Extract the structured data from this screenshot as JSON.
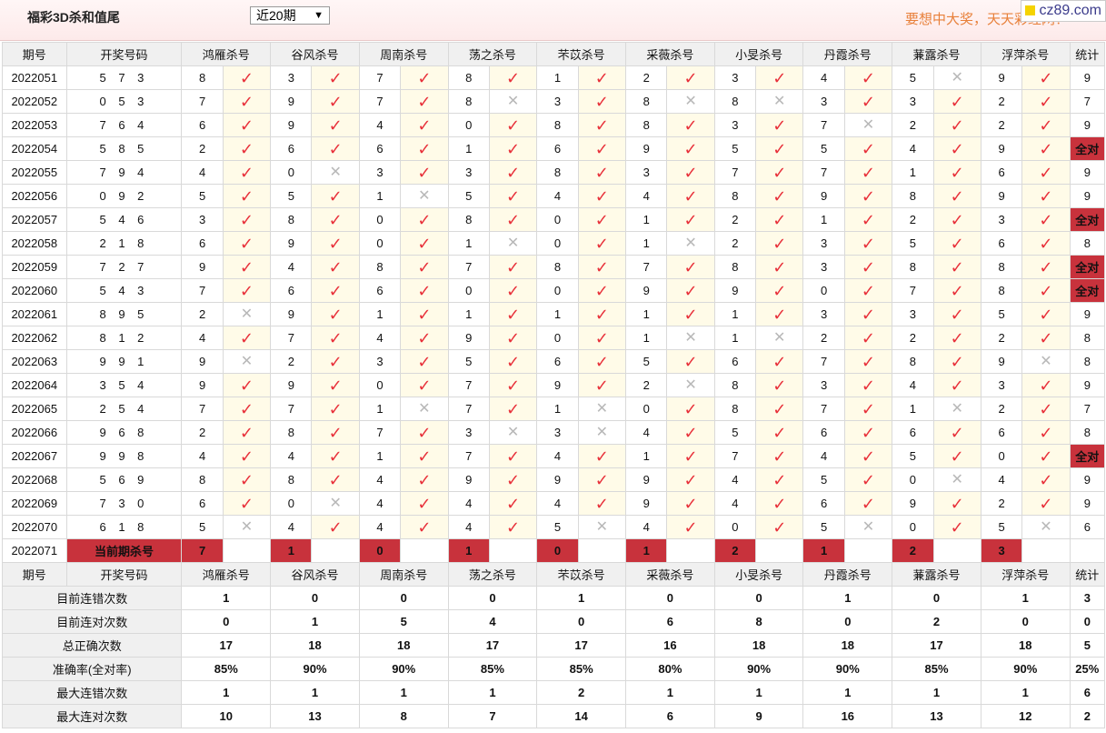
{
  "header": {
    "title": "福彩3D杀和值尾",
    "select_value": "近20期",
    "slogan": "要想中大奖，天天彩经网！",
    "site_badge": "cz89.com"
  },
  "columns": {
    "period": "期号",
    "draw": "开奖号码",
    "experts": [
      "鸿雁杀号",
      "谷风杀号",
      "周南杀号",
      "荡之杀号",
      "芣苡杀号",
      "采薇杀号",
      "小旻杀号",
      "丹霞杀号",
      "蒹露杀号",
      "浮萍杀号"
    ],
    "stat": "统计"
  },
  "rows": [
    {
      "period": "2022051",
      "draw": "5 7 3",
      "kills": [
        "8",
        "3",
        "7",
        "8",
        "1",
        "2",
        "3",
        "4",
        "5",
        "9"
      ],
      "ok": [
        1,
        1,
        1,
        1,
        1,
        1,
        1,
        1,
        0,
        1
      ],
      "stat": "9"
    },
    {
      "period": "2022052",
      "draw": "0 5 3",
      "kills": [
        "7",
        "9",
        "7",
        "8",
        "3",
        "8",
        "8",
        "3",
        "3",
        "2"
      ],
      "ok": [
        1,
        1,
        1,
        0,
        1,
        0,
        0,
        1,
        1,
        1
      ],
      "stat": "7"
    },
    {
      "period": "2022053",
      "draw": "7 6 4",
      "kills": [
        "6",
        "9",
        "4",
        "0",
        "8",
        "8",
        "3",
        "7",
        "2",
        "2"
      ],
      "ok": [
        1,
        1,
        1,
        1,
        1,
        1,
        1,
        0,
        1,
        1
      ],
      "stat": "9"
    },
    {
      "period": "2022054",
      "draw": "5 8 5",
      "kills": [
        "2",
        "6",
        "6",
        "1",
        "6",
        "9",
        "5",
        "5",
        "4",
        "9"
      ],
      "ok": [
        1,
        1,
        1,
        1,
        1,
        1,
        1,
        1,
        1,
        1
      ],
      "stat": "全对"
    },
    {
      "period": "2022055",
      "draw": "7 9 4",
      "kills": [
        "4",
        "0",
        "3",
        "3",
        "8",
        "3",
        "7",
        "7",
        "1",
        "6"
      ],
      "ok": [
        1,
        0,
        1,
        1,
        1,
        1,
        1,
        1,
        1,
        1
      ],
      "stat": "9"
    },
    {
      "period": "2022056",
      "draw": "0 9 2",
      "kills": [
        "5",
        "5",
        "1",
        "5",
        "4",
        "4",
        "8",
        "9",
        "8",
        "9"
      ],
      "ok": [
        1,
        1,
        0,
        1,
        1,
        1,
        1,
        1,
        1,
        1
      ],
      "stat": "9"
    },
    {
      "period": "2022057",
      "draw": "5 4 6",
      "kills": [
        "3",
        "8",
        "0",
        "8",
        "0",
        "1",
        "2",
        "1",
        "2",
        "3"
      ],
      "ok": [
        1,
        1,
        1,
        1,
        1,
        1,
        1,
        1,
        1,
        1
      ],
      "stat": "全对"
    },
    {
      "period": "2022058",
      "draw": "2 1 8",
      "kills": [
        "6",
        "9",
        "0",
        "1",
        "0",
        "1",
        "2",
        "3",
        "5",
        "6"
      ],
      "ok": [
        1,
        1,
        1,
        0,
        1,
        0,
        1,
        1,
        1,
        1
      ],
      "stat": "8"
    },
    {
      "period": "2022059",
      "draw": "7 2 7",
      "kills": [
        "9",
        "4",
        "8",
        "7",
        "8",
        "7",
        "8",
        "3",
        "8",
        "8"
      ],
      "ok": [
        1,
        1,
        1,
        1,
        1,
        1,
        1,
        1,
        1,
        1
      ],
      "stat": "全对"
    },
    {
      "period": "2022060",
      "draw": "5 4 3",
      "kills": [
        "7",
        "6",
        "6",
        "0",
        "0",
        "9",
        "9",
        "0",
        "7",
        "8"
      ],
      "ok": [
        1,
        1,
        1,
        1,
        1,
        1,
        1,
        1,
        1,
        1
      ],
      "stat": "全对"
    },
    {
      "period": "2022061",
      "draw": "8 9 5",
      "kills": [
        "2",
        "9",
        "1",
        "1",
        "1",
        "1",
        "1",
        "3",
        "3",
        "5"
      ],
      "ok": [
        0,
        1,
        1,
        1,
        1,
        1,
        1,
        1,
        1,
        1
      ],
      "stat": "9"
    },
    {
      "period": "2022062",
      "draw": "8 1 2",
      "kills": [
        "4",
        "7",
        "4",
        "9",
        "0",
        "1",
        "1",
        "2",
        "2",
        "2"
      ],
      "ok": [
        1,
        1,
        1,
        1,
        1,
        0,
        0,
        1,
        1,
        1
      ],
      "stat": "8"
    },
    {
      "period": "2022063",
      "draw": "9 9 1",
      "kills": [
        "9",
        "2",
        "3",
        "5",
        "6",
        "5",
        "6",
        "7",
        "8",
        "9"
      ],
      "ok": [
        0,
        1,
        1,
        1,
        1,
        1,
        1,
        1,
        1,
        0
      ],
      "stat": "8"
    },
    {
      "period": "2022064",
      "draw": "3 5 4",
      "kills": [
        "9",
        "9",
        "0",
        "7",
        "9",
        "2",
        "8",
        "3",
        "4",
        "3"
      ],
      "ok": [
        1,
        1,
        1,
        1,
        1,
        0,
        1,
        1,
        1,
        1
      ],
      "stat": "9"
    },
    {
      "period": "2022065",
      "draw": "2 5 4",
      "kills": [
        "7",
        "7",
        "1",
        "7",
        "1",
        "0",
        "8",
        "7",
        "1",
        "2"
      ],
      "ok": [
        1,
        1,
        0,
        1,
        0,
        1,
        1,
        1,
        0,
        1
      ],
      "stat": "7"
    },
    {
      "period": "2022066",
      "draw": "9 6 8",
      "kills": [
        "2",
        "8",
        "7",
        "3",
        "3",
        "4",
        "5",
        "6",
        "6",
        "6"
      ],
      "ok": [
        1,
        1,
        1,
        0,
        0,
        1,
        1,
        1,
        1,
        1
      ],
      "stat": "8"
    },
    {
      "period": "2022067",
      "draw": "9 9 8",
      "kills": [
        "4",
        "4",
        "1",
        "7",
        "4",
        "1",
        "7",
        "4",
        "5",
        "0"
      ],
      "ok": [
        1,
        1,
        1,
        1,
        1,
        1,
        1,
        1,
        1,
        1
      ],
      "stat": "全对"
    },
    {
      "period": "2022068",
      "draw": "5 6 9",
      "kills": [
        "8",
        "8",
        "4",
        "9",
        "9",
        "9",
        "4",
        "5",
        "0",
        "4"
      ],
      "ok": [
        1,
        1,
        1,
        1,
        1,
        1,
        1,
        1,
        0,
        1
      ],
      "stat": "9"
    },
    {
      "period": "2022069",
      "draw": "7 3 0",
      "kills": [
        "6",
        "0",
        "4",
        "4",
        "4",
        "9",
        "4",
        "6",
        "9",
        "2"
      ],
      "ok": [
        1,
        0,
        1,
        1,
        1,
        1,
        1,
        1,
        1,
        1
      ],
      "stat": "9"
    },
    {
      "period": "2022070",
      "draw": "6 1 8",
      "kills": [
        "5",
        "4",
        "4",
        "4",
        "5",
        "4",
        "0",
        "5",
        "0",
        "5"
      ],
      "ok": [
        0,
        1,
        1,
        1,
        0,
        1,
        1,
        0,
        1,
        0
      ],
      "stat": "6"
    }
  ],
  "current": {
    "period": "2022071",
    "label": "当前期杀号",
    "kills": [
      "7",
      "1",
      "0",
      "1",
      "0",
      "1",
      "2",
      "1",
      "2",
      "3"
    ]
  },
  "stats": [
    {
      "label": "目前连错次数",
      "values": [
        "1",
        "0",
        "0",
        "0",
        "1",
        "0",
        "0",
        "1",
        "0",
        "1"
      ],
      "total": "3",
      "pct": false
    },
    {
      "label": "目前连对次数",
      "values": [
        "0",
        "1",
        "5",
        "4",
        "0",
        "6",
        "8",
        "0",
        "2",
        "0"
      ],
      "total": "0",
      "pct": false
    },
    {
      "label": "总正确次数",
      "values": [
        "17",
        "18",
        "18",
        "17",
        "17",
        "16",
        "18",
        "18",
        "17",
        "18"
      ],
      "total": "5",
      "pct": false
    },
    {
      "label": "准确率(全对率)",
      "values": [
        "85%",
        "90%",
        "90%",
        "85%",
        "85%",
        "80%",
        "90%",
        "90%",
        "85%",
        "90%"
      ],
      "total": "25%",
      "pct": true
    },
    {
      "label": "最大连错次数",
      "values": [
        "1",
        "1",
        "1",
        "1",
        "2",
        "1",
        "1",
        "1",
        "1",
        "1"
      ],
      "total": "6",
      "pct": false
    },
    {
      "label": "最大连对次数",
      "values": [
        "10",
        "13",
        "8",
        "7",
        "14",
        "6",
        "9",
        "16",
        "13",
        "12"
      ],
      "total": "2",
      "pct": false
    }
  ],
  "icons": {
    "correct": "check-icon",
    "wrong": "cross-icon"
  },
  "colors": {
    "accent": "#c8323c",
    "check": "#e8303a",
    "stat_value": "#1a3fa8",
    "stat_pct": "#d0202a"
  }
}
